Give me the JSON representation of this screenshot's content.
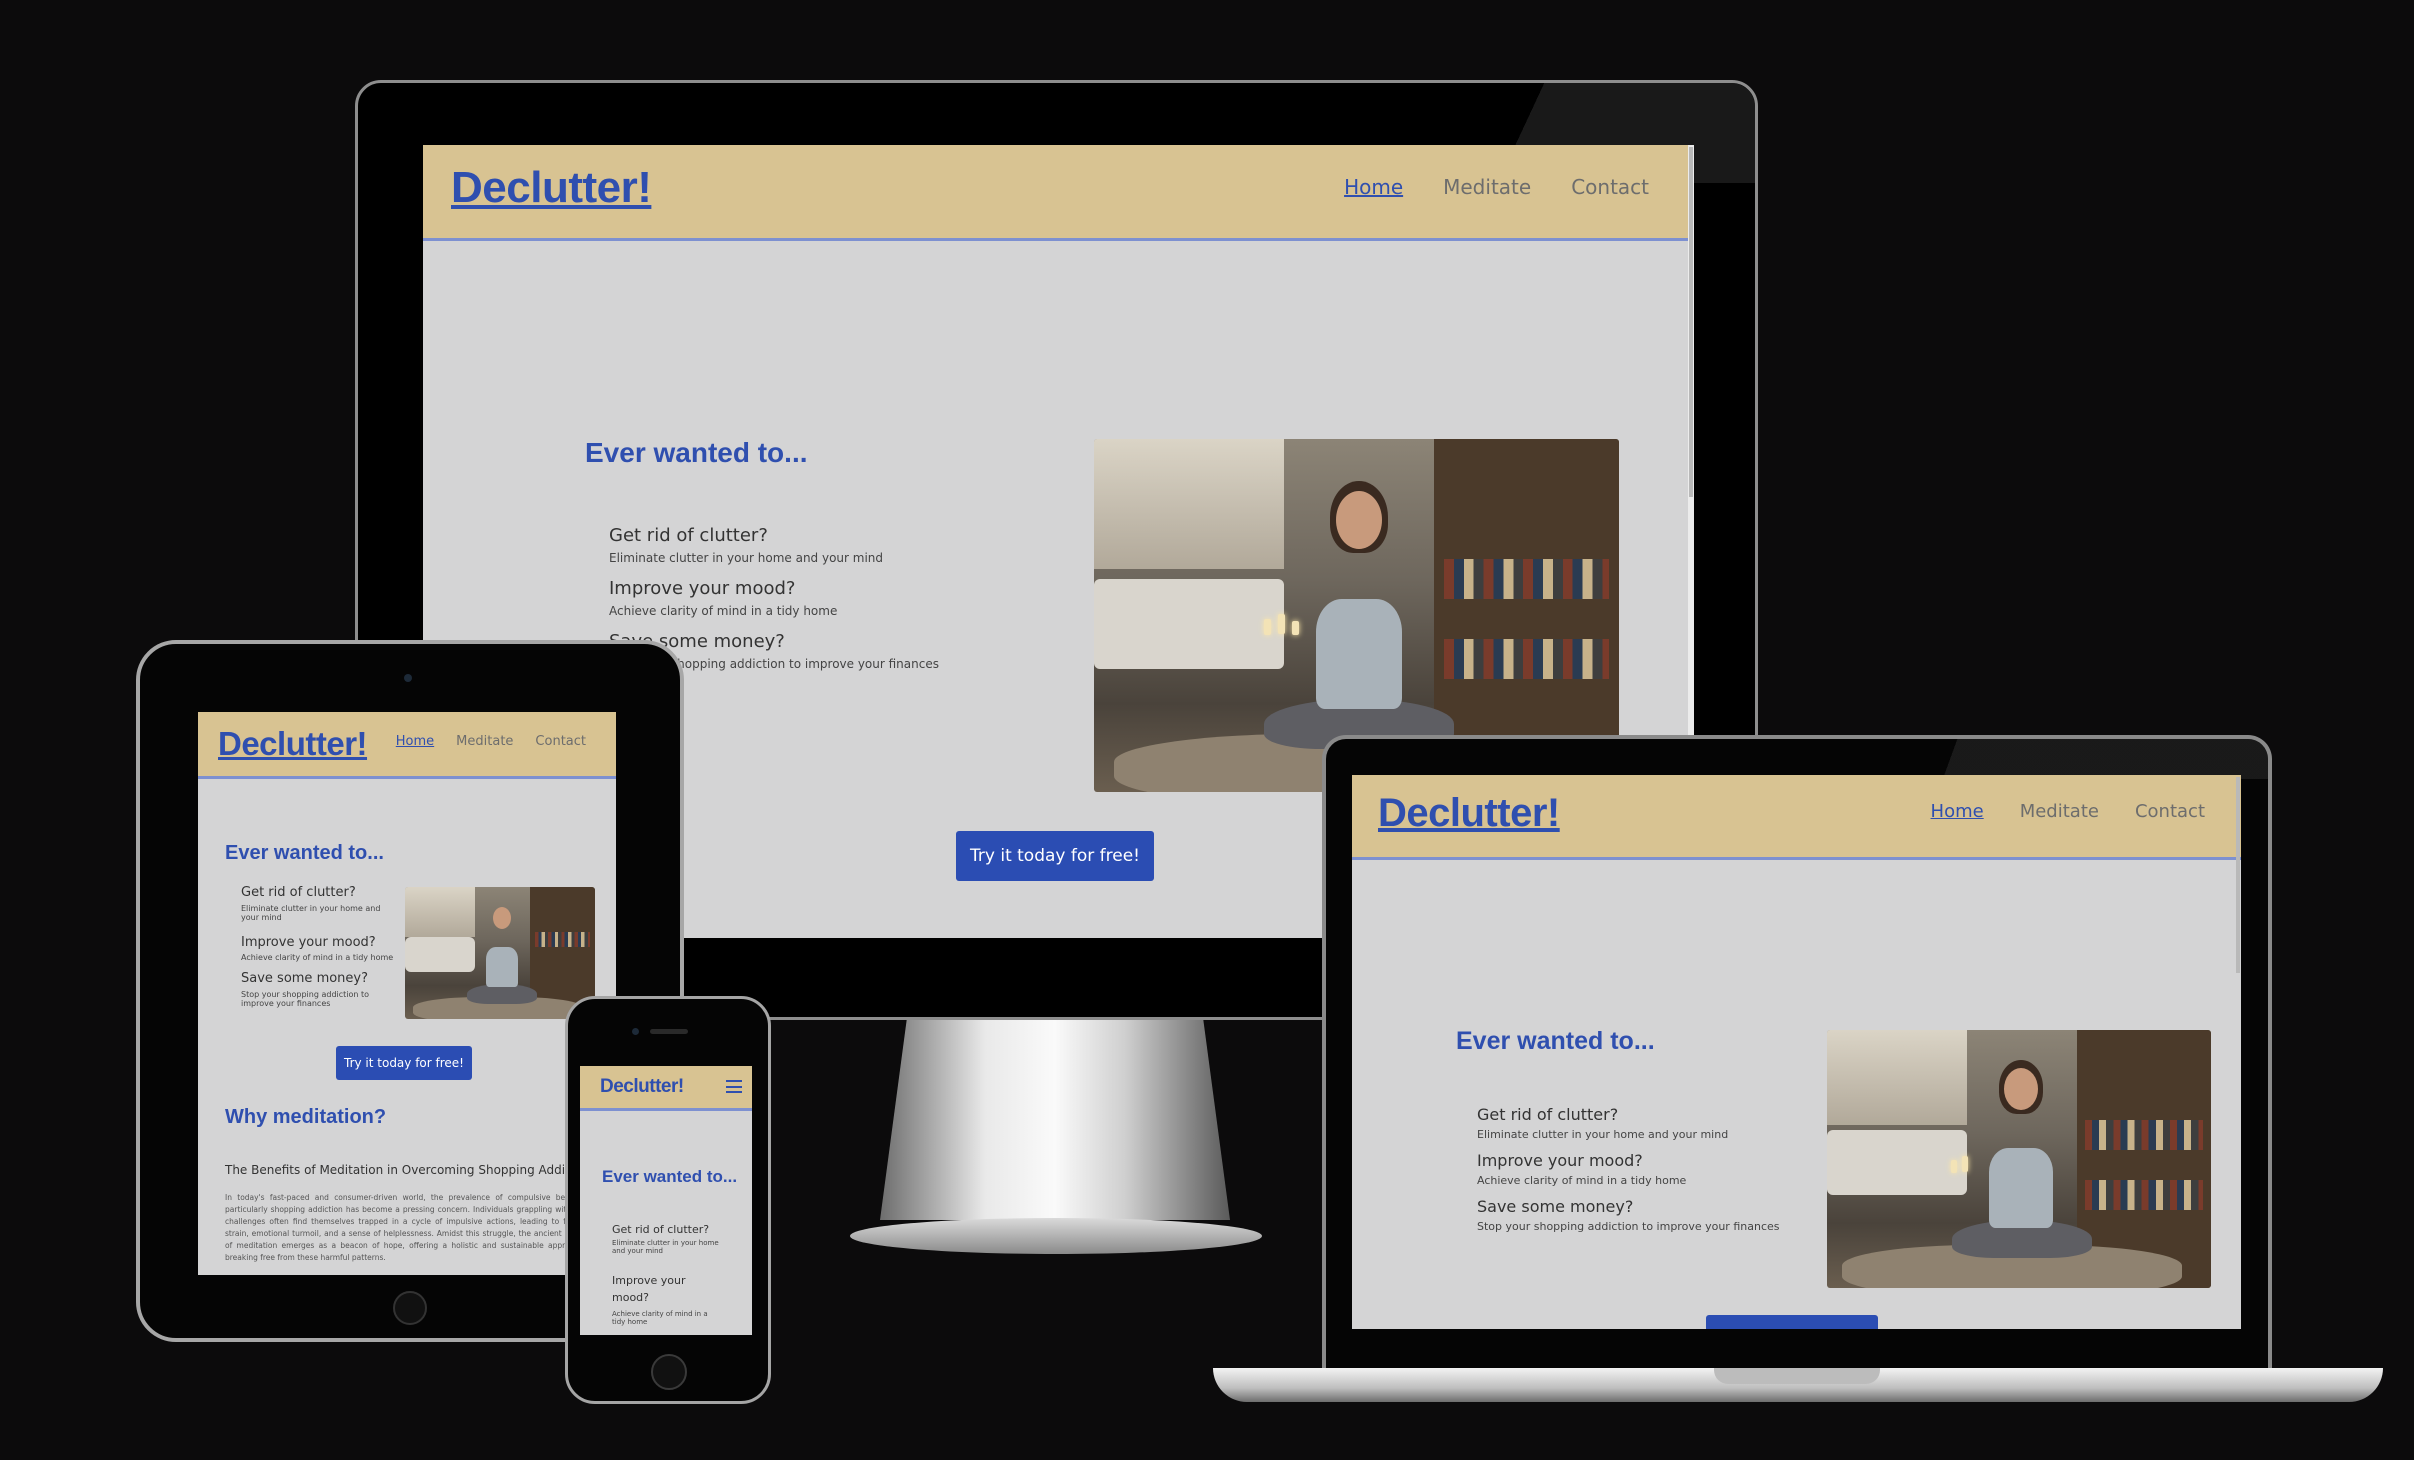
{
  "site": {
    "logo": "Declutter!",
    "nav": [
      "Home",
      "Meditate",
      "Contact"
    ],
    "active_nav": "Home",
    "hero_heading": "Ever wanted to...",
    "items": [
      {
        "title": "Get rid of clutter?",
        "sub": "Eliminate clutter in your home and your mind"
      },
      {
        "title": "Improve your mood?",
        "sub": "Achieve clarity of mind in a tidy home"
      },
      {
        "title": "Save some money?",
        "sub": "Stop your shopping addiction to improve your finances"
      }
    ],
    "cta": "Try it today for free!",
    "why_heading": "Why meditation?",
    "article_title": "The Benefits of Meditation in Overcoming Shopping Addiction",
    "article_body": "In today's fast-paced and consumer-driven world, the prevalence of compulsive behaviors, particularly shopping addiction has become a pressing concern. Individuals grappling with these challenges often find themselves trapped in a cycle of impulsive actions, leading to financial strain, emotional turmoil, and a sense of helplessness. Amidst this struggle, the ancient practice of meditation emerges as a beacon of hope, offering a holistic and sustainable approach to breaking free from these harmful patterns.",
    "photo_icon": "woman-meditating-photo",
    "menu_icon": "hamburger-menu-icon"
  },
  "colors": {
    "background": "#0c0b0c",
    "header": "#d8c392",
    "page": "#d4d4d5",
    "accent_blue": "#2f4faf",
    "button": "#2b4db3",
    "nav_grey": "#6d6d6d"
  },
  "devices": [
    "desktop-monitor",
    "tablet",
    "laptop",
    "phone"
  ]
}
